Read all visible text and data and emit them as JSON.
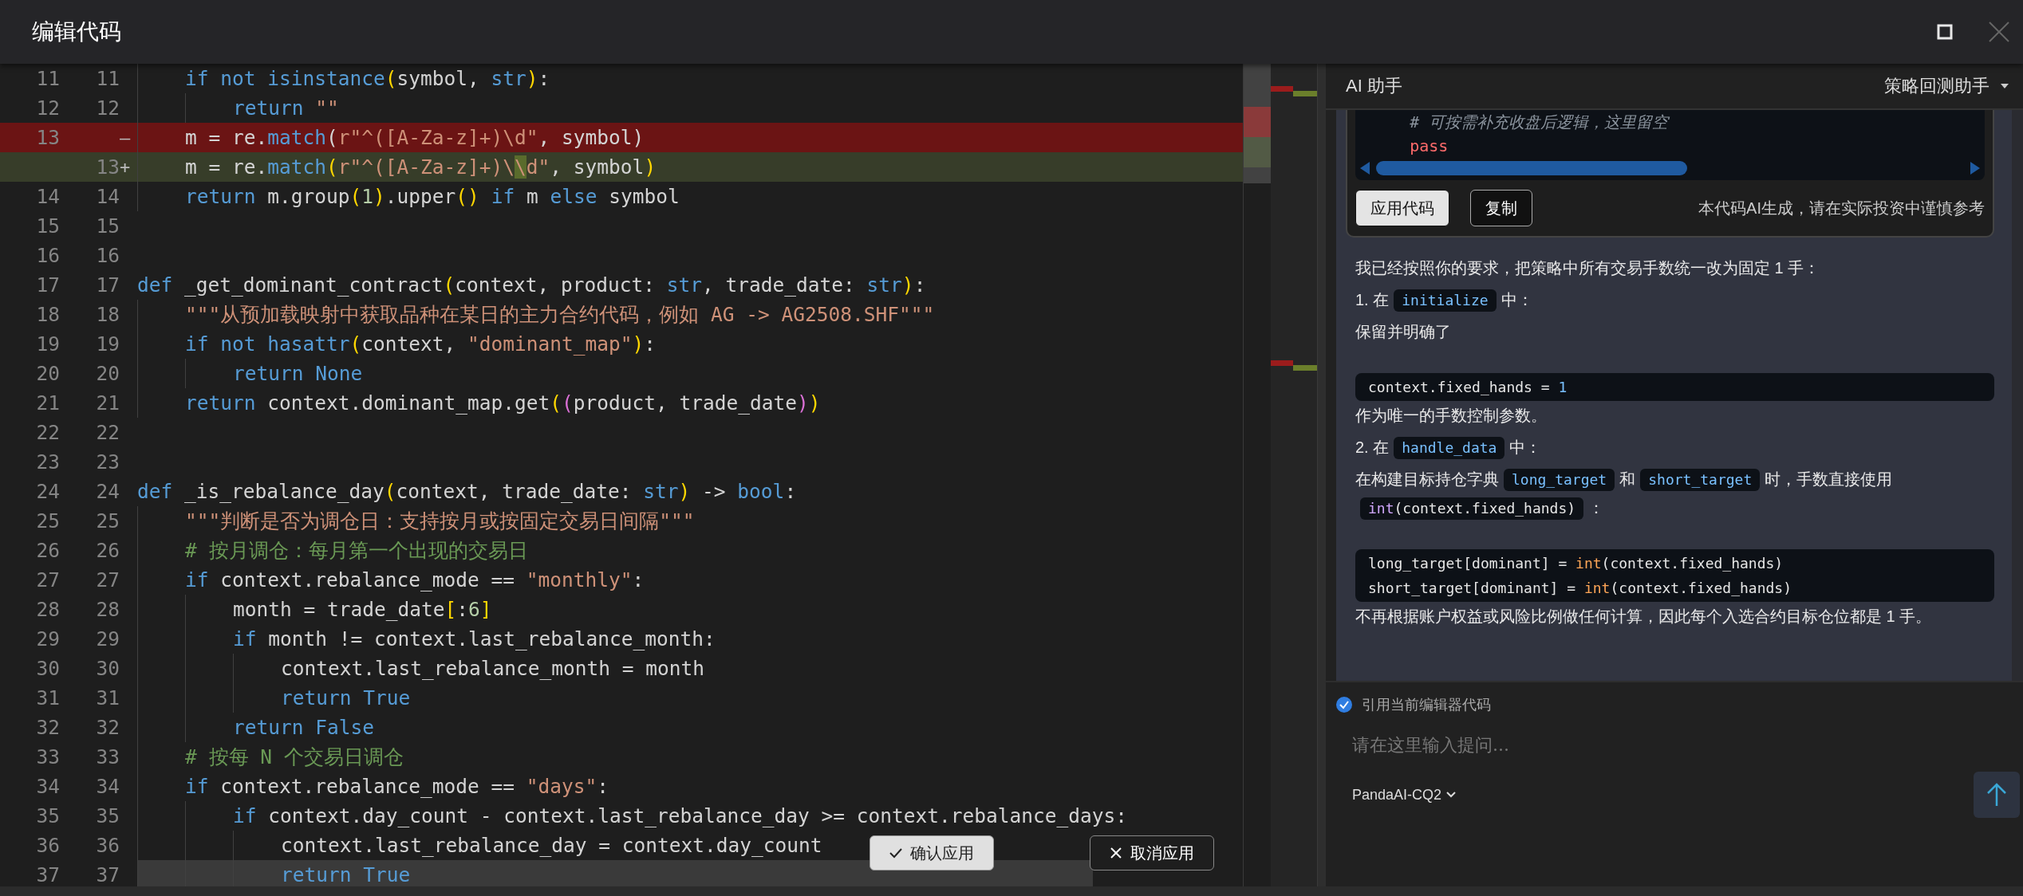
{
  "window": {
    "title": "编辑代码"
  },
  "editor": {
    "lines": [
      {
        "old": "11",
        "new": "11",
        "removed": false,
        "added": false,
        "current": false,
        "tokens": [
          {
            "text": "    if not isinstance",
            "kind": "kw"
          },
          {
            "text": "(",
            "kind": "b1"
          },
          {
            "text": "symbol, ",
            "kind": "p"
          },
          {
            "text": "str",
            "kind": "kw"
          },
          {
            "text": ")",
            "kind": "b1"
          },
          {
            "text": ":",
            "kind": "p"
          }
        ]
      },
      {
        "old": "12",
        "new": "12",
        "removed": false,
        "added": false,
        "current": false,
        "tokens": [
          {
            "text": "        return",
            "kind": "kw"
          },
          {
            "text": " \"\"",
            "kind": "str"
          }
        ]
      },
      {
        "old": "13",
        "removed": true,
        "added": false,
        "marker": "—",
        "current": false,
        "tokens": [
          {
            "text": "    m = re.",
            "kind": "p"
          },
          {
            "text": "match",
            "kind": "kw"
          },
          {
            "text": "(",
            "kind": "p"
          },
          {
            "text": "r\"^([A-Za-z]+)\\d\"",
            "kind": "str"
          },
          {
            "text": ", symbol)",
            "kind": "p"
          }
        ]
      },
      {
        "new": "13",
        "removed": false,
        "added": true,
        "marker": "+",
        "current": false,
        "tokens": [
          {
            "text": "    m = re.",
            "kind": "p"
          },
          {
            "text": "match",
            "kind": "kw"
          },
          {
            "text": "(",
            "kind": "b1"
          },
          {
            "text": "r\"^([A-Za-z]+)\\",
            "kind": "str"
          },
          {
            "text": "\\",
            "kind": "chg"
          },
          {
            "text": "d\"",
            "kind": "str"
          },
          {
            "text": ", symbol",
            "kind": "p"
          },
          {
            "text": ")",
            "kind": "b1"
          }
        ]
      },
      {
        "old": "14",
        "new": "14",
        "removed": false,
        "added": false,
        "current": false,
        "tokens": [
          {
            "text": "    return",
            "kind": "kw"
          },
          {
            "text": " m.group",
            "kind": "p"
          },
          {
            "text": "(",
            "kind": "b1"
          },
          {
            "text": "1",
            "kind": "num"
          },
          {
            "text": ")",
            "kind": "b1"
          },
          {
            "text": ".upper",
            "kind": "p"
          },
          {
            "text": "()",
            "kind": "b1"
          },
          {
            "text": " if",
            "kind": "kw"
          },
          {
            "text": " m ",
            "kind": "p"
          },
          {
            "text": "else",
            "kind": "kw"
          },
          {
            "text": " symbol",
            "kind": "p"
          }
        ]
      },
      {
        "old": "15",
        "new": "15",
        "removed": false,
        "added": false,
        "current": false
      },
      {
        "old": "16",
        "new": "16",
        "removed": false,
        "added": false,
        "current": false
      },
      {
        "old": "17",
        "new": "17",
        "removed": false,
        "added": false,
        "current": false,
        "tokens": [
          {
            "text": "def",
            "kind": "kw"
          },
          {
            "text": " _get_dominant_contract",
            "kind": "p"
          },
          {
            "text": "(",
            "kind": "b1"
          },
          {
            "text": "context, product: ",
            "kind": "p"
          },
          {
            "text": "str",
            "kind": "kw"
          },
          {
            "text": ", trade_date: ",
            "kind": "p"
          },
          {
            "text": "str",
            "kind": "kw"
          },
          {
            "text": ")",
            "kind": "b1"
          },
          {
            "text": ":",
            "kind": "p"
          }
        ]
      },
      {
        "old": "18",
        "new": "18",
        "removed": false,
        "added": false,
        "current": false,
        "tokens": [
          {
            "text": "    \"\"\"从预加载映射中获取品种在某日的主力合约代码，例如 AG -> AG2508.SHF\"\"\"",
            "kind": "str"
          }
        ]
      },
      {
        "old": "19",
        "new": "19",
        "removed": false,
        "added": false,
        "current": false,
        "tokens": [
          {
            "text": "    if not hasattr",
            "kind": "kw"
          },
          {
            "text": "(",
            "kind": "b1"
          },
          {
            "text": "context, ",
            "kind": "p"
          },
          {
            "text": "\"dominant_map\"",
            "kind": "str"
          },
          {
            "text": ")",
            "kind": "b1"
          },
          {
            "text": ":",
            "kind": "p"
          }
        ]
      },
      {
        "old": "20",
        "new": "20",
        "removed": false,
        "added": false,
        "current": false,
        "tokens": [
          {
            "text": "        return None",
            "kind": "kw"
          }
        ]
      },
      {
        "old": "21",
        "new": "21",
        "removed": false,
        "added": false,
        "current": false,
        "tokens": [
          {
            "text": "    return",
            "kind": "kw"
          },
          {
            "text": " context.dominant_map.get",
            "kind": "p"
          },
          {
            "text": "(",
            "kind": "b1"
          },
          {
            "text": "(",
            "kind": "b2"
          },
          {
            "text": "product, trade_date",
            "kind": "p"
          },
          {
            "text": ")",
            "kind": "b2"
          },
          {
            "text": ")",
            "kind": "b1"
          }
        ]
      },
      {
        "old": "22",
        "new": "22",
        "removed": false,
        "added": false,
        "current": false
      },
      {
        "old": "23",
        "new": "23",
        "removed": false,
        "added": false,
        "current": false
      },
      {
        "old": "24",
        "new": "24",
        "removed": false,
        "added": false,
        "current": false,
        "tokens": [
          {
            "text": "def",
            "kind": "kw"
          },
          {
            "text": " _is_rebalance_day",
            "kind": "p"
          },
          {
            "text": "(",
            "kind": "b1"
          },
          {
            "text": "context, trade_date: ",
            "kind": "p"
          },
          {
            "text": "str",
            "kind": "kw"
          },
          {
            "text": ")",
            "kind": "b1"
          },
          {
            "text": " -> ",
            "kind": "p"
          },
          {
            "text": "bool",
            "kind": "kw"
          },
          {
            "text": ":",
            "kind": "p"
          }
        ]
      },
      {
        "old": "25",
        "new": "25",
        "removed": false,
        "added": false,
        "current": false,
        "tokens": [
          {
            "text": "    \"\"\"判断是否为调仓日：支持按月或按固定交易日间隔\"\"\"",
            "kind": "str"
          }
        ]
      },
      {
        "old": "26",
        "new": "26",
        "removed": false,
        "added": false,
        "current": false,
        "tokens": [
          {
            "text": "    # 按月调仓：每月第一个出现的交易日",
            "kind": "cm"
          }
        ]
      },
      {
        "old": "27",
        "new": "27",
        "removed": false,
        "added": false,
        "current": false,
        "tokens": [
          {
            "text": "    if",
            "kind": "kw"
          },
          {
            "text": " context.rebalance_mode == ",
            "kind": "p"
          },
          {
            "text": "\"monthly\"",
            "kind": "str"
          },
          {
            "text": ":",
            "kind": "p"
          }
        ]
      },
      {
        "old": "28",
        "new": "28",
        "removed": false,
        "added": false,
        "current": false,
        "tokens": [
          {
            "text": "        month = trade_date",
            "kind": "p"
          },
          {
            "text": "[",
            "kind": "b1"
          },
          {
            "text": ":",
            "kind": "p"
          },
          {
            "text": "6",
            "kind": "num"
          },
          {
            "text": "]",
            "kind": "b1"
          }
        ]
      },
      {
        "old": "29",
        "new": "29",
        "removed": false,
        "added": false,
        "current": false,
        "tokens": [
          {
            "text": "        if",
            "kind": "kw"
          },
          {
            "text": " month != context.last_rebalance_month:",
            "kind": "p"
          }
        ]
      },
      {
        "old": "30",
        "new": "30",
        "removed": false,
        "added": false,
        "current": false,
        "tokens": [
          {
            "text": "            context.last_rebalance_month = month",
            "kind": "p"
          }
        ]
      },
      {
        "old": "31",
        "new": "31",
        "removed": false,
        "added": false,
        "current": false,
        "tokens": [
          {
            "text": "            return True",
            "kind": "kw"
          }
        ]
      },
      {
        "old": "32",
        "new": "32",
        "removed": false,
        "added": false,
        "current": false,
        "tokens": [
          {
            "text": "        return False",
            "kind": "kw"
          }
        ]
      },
      {
        "old": "33",
        "new": "33",
        "removed": false,
        "added": false,
        "current": false,
        "tokens": [
          {
            "text": "    # 按每 N 个交易日调仓",
            "kind": "cm"
          }
        ]
      },
      {
        "old": "34",
        "new": "34",
        "removed": false,
        "added": false,
        "current": false,
        "tokens": [
          {
            "text": "    if",
            "kind": "kw"
          },
          {
            "text": " context.rebalance_mode == ",
            "kind": "p"
          },
          {
            "text": "\"days\"",
            "kind": "str"
          },
          {
            "text": ":",
            "kind": "p"
          }
        ]
      },
      {
        "old": "35",
        "new": "35",
        "removed": false,
        "added": false,
        "current": false,
        "tokens": [
          {
            "text": "        if",
            "kind": "kw"
          },
          {
            "text": " context.day_count - context.last_rebalance_day >= context.rebalance_days:",
            "kind": "p"
          }
        ]
      },
      {
        "old": "36",
        "new": "36",
        "removed": false,
        "added": false,
        "current": false,
        "tokens": [
          {
            "text": "            context.last_rebalance_day = context.day_count",
            "kind": "p"
          }
        ]
      },
      {
        "old": "37",
        "new": "37",
        "removed": false,
        "added": false,
        "current": true,
        "tokens": [
          {
            "text": "            return True",
            "kind": "kw"
          }
        ]
      }
    ],
    "diff_actions": [
      {
        "label": "确认应用",
        "kind": "confirm"
      },
      {
        "label": "取消应用",
        "kind": "cancel"
      }
    ]
  },
  "assistant": {
    "title": "AI 助手",
    "mode": "策略回测助手",
    "code_card": {
      "lines": [
        [
          {
            "text": "    # 可按需补充收盘后逻辑，这里留空",
            "kind": "cm"
          }
        ],
        [
          {
            "text": "    pass",
            "kind": "red"
          }
        ]
      ],
      "buttons": [
        {
          "label": "应用代码",
          "kind": "primary"
        },
        {
          "label": "复制",
          "kind": "secondary"
        }
      ],
      "note": "本代码AI生成，请在实际投资中谨慎参考"
    },
    "blocks": [
      {
        "kind": "para",
        "segs": [
          {
            "kind": "text",
            "text": "我已经按照你的要求，把策略中所有交易手数统一改为固定 1 手："
          }
        ]
      },
      {
        "kind": "para",
        "segs": [
          {
            "kind": "text",
            "text": "1. 在"
          },
          {
            "kind": "code",
            "tokens": [
              {
                "text": "initialize",
                "kind": "id"
              }
            ]
          },
          {
            "kind": "text",
            "text": "中："
          }
        ]
      },
      {
        "kind": "para",
        "segs": [
          {
            "kind": "text",
            "text": "保留并明确了"
          }
        ]
      },
      {
        "kind": "code",
        "lines": [
          [
            {
              "text": "context.fixed_hands = ",
              "kind": "p"
            },
            {
              "text": "1",
              "kind": "num"
            }
          ]
        ]
      },
      {
        "kind": "para",
        "segs": [
          {
            "kind": "text",
            "text": "作为唯一的手数控制参数。"
          }
        ]
      },
      {
        "kind": "para",
        "segs": [
          {
            "kind": "text",
            "text": "2. 在"
          },
          {
            "kind": "code",
            "tokens": [
              {
                "text": "handle_data",
                "kind": "id"
              }
            ]
          },
          {
            "kind": "text",
            "text": "中："
          }
        ]
      },
      {
        "kind": "para",
        "segs": [
          {
            "kind": "text",
            "text": "在构建目标持仓字典"
          },
          {
            "kind": "code",
            "tokens": [
              {
                "text": "long_target",
                "kind": "id"
              }
            ]
          },
          {
            "kind": "text",
            "text": "和"
          },
          {
            "kind": "code",
            "tokens": [
              {
                "text": "short_target",
                "kind": "id"
              }
            ]
          },
          {
            "kind": "text",
            "text": "时，手数直接使用"
          },
          {
            "kind": "code",
            "tokens": [
              {
                "text": "int",
                "kind": "fn"
              },
              {
                "text": "(context.fixed_hands)",
                "kind": "p"
              }
            ]
          },
          {
            "kind": "text",
            "text": "："
          }
        ]
      },
      {
        "kind": "code",
        "lines": [
          [
            {
              "text": "long_target[dominant] = ",
              "kind": "p"
            },
            {
              "text": "int",
              "kind": "org"
            },
            {
              "text": "(context.fixed_hands)",
              "kind": "p"
            }
          ],
          [
            {
              "text": "short_target[dominant] = ",
              "kind": "p"
            },
            {
              "text": "int",
              "kind": "org"
            },
            {
              "text": "(context.fixed_hands)",
              "kind": "p"
            }
          ]
        ]
      },
      {
        "kind": "para",
        "segs": [
          {
            "kind": "text",
            "text": "不再根据账户权益或风险比例做任何计算，因此每个入选合约目标仓位都是 1 手。"
          }
        ]
      }
    ],
    "composer": {
      "quote": {
        "label": "引用当前编辑器代码",
        "checked": true
      },
      "placeholder": "请在这里输入提问...",
      "model": "PandaAI-CQ2"
    }
  }
}
